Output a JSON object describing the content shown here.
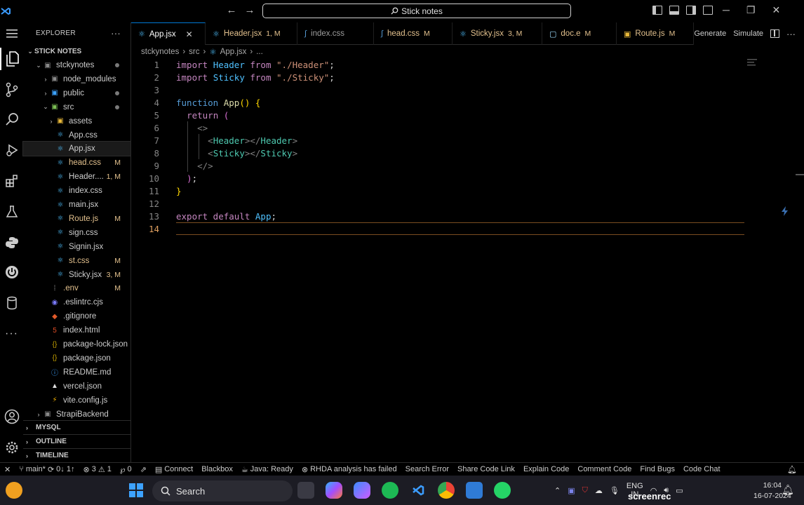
{
  "titlebar": {
    "search_text": "Stick notes",
    "back_glyph": "←",
    "forward_glyph": "→"
  },
  "sidebar": {
    "title": "EXPLORER",
    "more_glyph": "···",
    "root": "STICK NOTES",
    "items": [
      {
        "label": "stckynotes",
        "badge": ""
      },
      {
        "label": "node_modules",
        "badge": ""
      },
      {
        "label": "public",
        "badge": ""
      },
      {
        "label": "src",
        "badge": ""
      },
      {
        "label": "assets",
        "badge": ""
      },
      {
        "label": "App.css",
        "badge": ""
      },
      {
        "label": "App.jsx",
        "badge": ""
      },
      {
        "label": "head.css",
        "badge": "M"
      },
      {
        "label": "Header....",
        "badge": "1, M"
      },
      {
        "label": "index.css",
        "badge": ""
      },
      {
        "label": "main.jsx",
        "badge": ""
      },
      {
        "label": "Route.js",
        "badge": "M"
      },
      {
        "label": "sign.css",
        "badge": ""
      },
      {
        "label": "Signin.jsx",
        "badge": ""
      },
      {
        "label": "st.css",
        "badge": "M"
      },
      {
        "label": "Sticky.jsx",
        "badge": "3, M"
      },
      {
        "label": ".env",
        "badge": "M"
      },
      {
        "label": ".eslintrc.cjs",
        "badge": ""
      },
      {
        "label": ".gitignore",
        "badge": ""
      },
      {
        "label": "index.html",
        "badge": ""
      },
      {
        "label": "package-lock.json",
        "badge": ""
      },
      {
        "label": "package.json",
        "badge": ""
      },
      {
        "label": "README.md",
        "badge": ""
      },
      {
        "label": "vercel.json",
        "badge": ""
      },
      {
        "label": "vite.config.js",
        "badge": ""
      },
      {
        "label": "StrapiBackend",
        "badge": ""
      }
    ],
    "sections": [
      "MYSQL",
      "OUTLINE",
      "TIMELINE"
    ]
  },
  "tabs": [
    {
      "label": "App.jsx",
      "mod": "",
      "icon": "react-icon"
    },
    {
      "label": "Header.jsx",
      "mod": "1, M",
      "icon": "react-icon"
    },
    {
      "label": "index.css",
      "mod": "",
      "icon": "css-icon"
    },
    {
      "label": "head.css",
      "mod": "M",
      "icon": "css-icon"
    },
    {
      "label": "Sticky.jsx",
      "mod": "3, M",
      "icon": "react-icon"
    },
    {
      "label": "doc.e",
      "mod": "M",
      "icon": "file-icon"
    },
    {
      "label": "Route.js",
      "mod": "M",
      "icon": "js-icon"
    }
  ],
  "tab_actions": {
    "generate": "Generate",
    "simulate": "Simulate"
  },
  "breadcrumb": [
    "stckynotes",
    "src",
    "App.jsx",
    "..."
  ],
  "editor": {
    "line_numbers": [
      "1",
      "2",
      "3",
      "4",
      "5",
      "6",
      "7",
      "8",
      "9",
      "10",
      "11",
      "12",
      "13",
      "14"
    ],
    "lines": [
      [
        [
          "kw2",
          "import "
        ],
        [
          "id",
          "Header "
        ],
        [
          "kw2",
          "from "
        ],
        [
          "str",
          "\"./Header\""
        ],
        [
          "punc",
          ";"
        ]
      ],
      [
        [
          "kw2",
          "import "
        ],
        [
          "id",
          "Sticky "
        ],
        [
          "kw2",
          "from "
        ],
        [
          "str",
          "\"./Sticky\""
        ],
        [
          "punc",
          ";"
        ]
      ],
      [],
      [
        [
          "kw",
          "function "
        ],
        [
          "fn",
          "App"
        ],
        [
          "gold",
          "() {"
        ]
      ],
      [
        [
          "punc",
          "  "
        ],
        [
          "kw2",
          "return "
        ],
        [
          "paren1",
          "("
        ]
      ],
      [
        [
          "punc",
          "    "
        ],
        [
          "brk",
          "<>"
        ]
      ],
      [
        [
          "punc",
          "      "
        ],
        [
          "brk",
          "<"
        ],
        [
          "tag",
          "Header"
        ],
        [
          "brk",
          "></"
        ],
        [
          "tag",
          "Header"
        ],
        [
          "brk",
          ">"
        ]
      ],
      [
        [
          "punc",
          "      "
        ],
        [
          "brk",
          "<"
        ],
        [
          "tag",
          "Sticky"
        ],
        [
          "brk",
          "></"
        ],
        [
          "tag",
          "Sticky"
        ],
        [
          "brk",
          ">"
        ]
      ],
      [
        [
          "punc",
          "    "
        ],
        [
          "brk",
          "</>"
        ]
      ],
      [
        [
          "punc",
          "  "
        ],
        [
          "paren1",
          ")"
        ],
        [
          "punc",
          ";"
        ]
      ],
      [
        [
          "gold",
          "}"
        ]
      ],
      [],
      [
        [
          "kw2",
          "export default "
        ],
        [
          "id",
          "App"
        ],
        [
          "punc",
          ";"
        ]
      ],
      []
    ]
  },
  "statusbar": {
    "branch": "main*",
    "sync": "0↓ 1↑",
    "errors": "3",
    "warnings": "1",
    "ports": "0",
    "items": [
      "Connect",
      "Blackbox",
      "Java: Ready",
      "RHDA analysis has failed",
      "Search Error",
      "Share Code Link",
      "Explain Code",
      "Comment Code",
      "Find Bugs",
      "Code Chat"
    ]
  },
  "taskbar": {
    "search_label": "Search",
    "language": "ENG",
    "language_sub": "IN",
    "time": "16:04",
    "date": "16-07-2024",
    "watermark": "screenrec"
  }
}
